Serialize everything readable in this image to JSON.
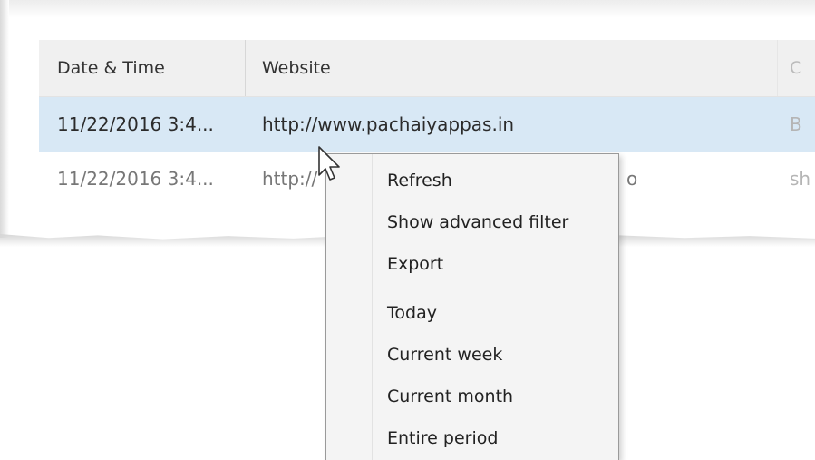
{
  "table": {
    "columns": [
      "Date & Time",
      "Website",
      "C"
    ],
    "rows": [
      {
        "date": "11/22/2016 3:4...",
        "website": "http://www.pachaiyappas.in",
        "third": "B"
      },
      {
        "date": "11/22/2016 3:4...",
        "website": "http://",
        "website_tail": "o",
        "third": "sh"
      }
    ]
  },
  "context_menu": {
    "items": [
      "Refresh",
      "Show advanced filter",
      "Export",
      "Today",
      "Current week",
      "Current month",
      "Entire period"
    ]
  },
  "colors": {
    "selected_row": "#d8e8f5",
    "header_bg": "#f0f0f0",
    "menu_bg": "#f4f4f4"
  }
}
